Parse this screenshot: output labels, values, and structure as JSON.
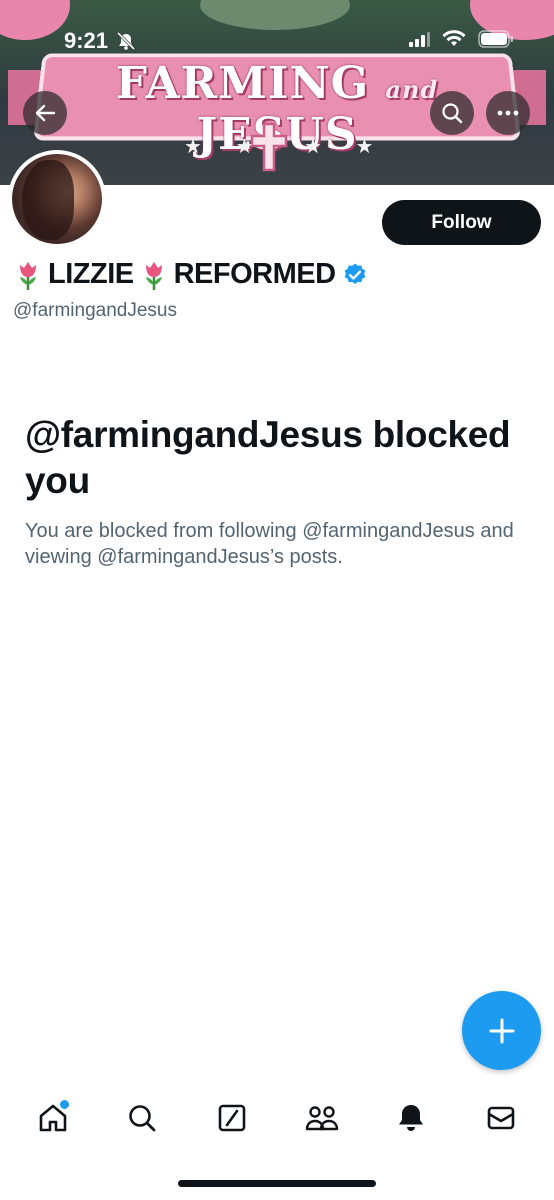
{
  "status_bar": {
    "time": "9:21"
  },
  "banner": {
    "title_left": "FARMING",
    "title_mid": "and",
    "title_right": "JESUS",
    "stars_left": "★ ★",
    "stars_right": "★ ★"
  },
  "profile": {
    "display_name_part1": "LIZZIE",
    "display_name_part2": "REFORMED",
    "handle": "@farmingandJesus",
    "follow_label": "Follow",
    "verified": true
  },
  "blocked": {
    "title": "@farmingandJesus blocked you",
    "description": "You are blocked from following @farmingandJesus and viewing @farmingandJesus’s posts."
  },
  "nav": {
    "items": [
      "home-icon",
      "search-icon",
      "grok-icon",
      "communities-icon",
      "notifications-icon",
      "messages-icon"
    ]
  },
  "colors": {
    "accent": "#1d9bf0",
    "text_primary": "#0f1419",
    "text_secondary": "#536471",
    "follow_bg": "#0f1419"
  }
}
